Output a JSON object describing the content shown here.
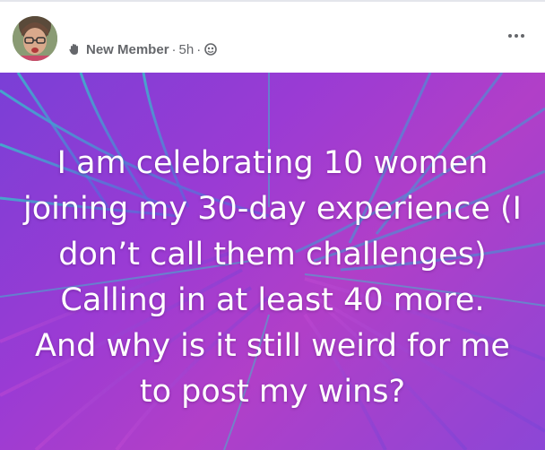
{
  "post": {
    "author_badge": "New Member",
    "separator": "·",
    "time": "5h",
    "separator2": "·",
    "audience_icon": "globe-icon",
    "badge_icon": "new-member-wave-icon",
    "more_icon": "more-options-icon",
    "text_lines": [
      "I am celebrating 10 women",
      "joining my 30-day experience (I",
      "don’t call them challenges)",
      "Calling in at least 40 more.",
      "And why is it still weird for me",
      "to post my wins?"
    ]
  },
  "colors": {
    "background_purple": "#9a3bd4",
    "background_pink": "#b13fc8",
    "leaf_teal": "#2fd0c8",
    "meta_gray": "#65676b"
  }
}
